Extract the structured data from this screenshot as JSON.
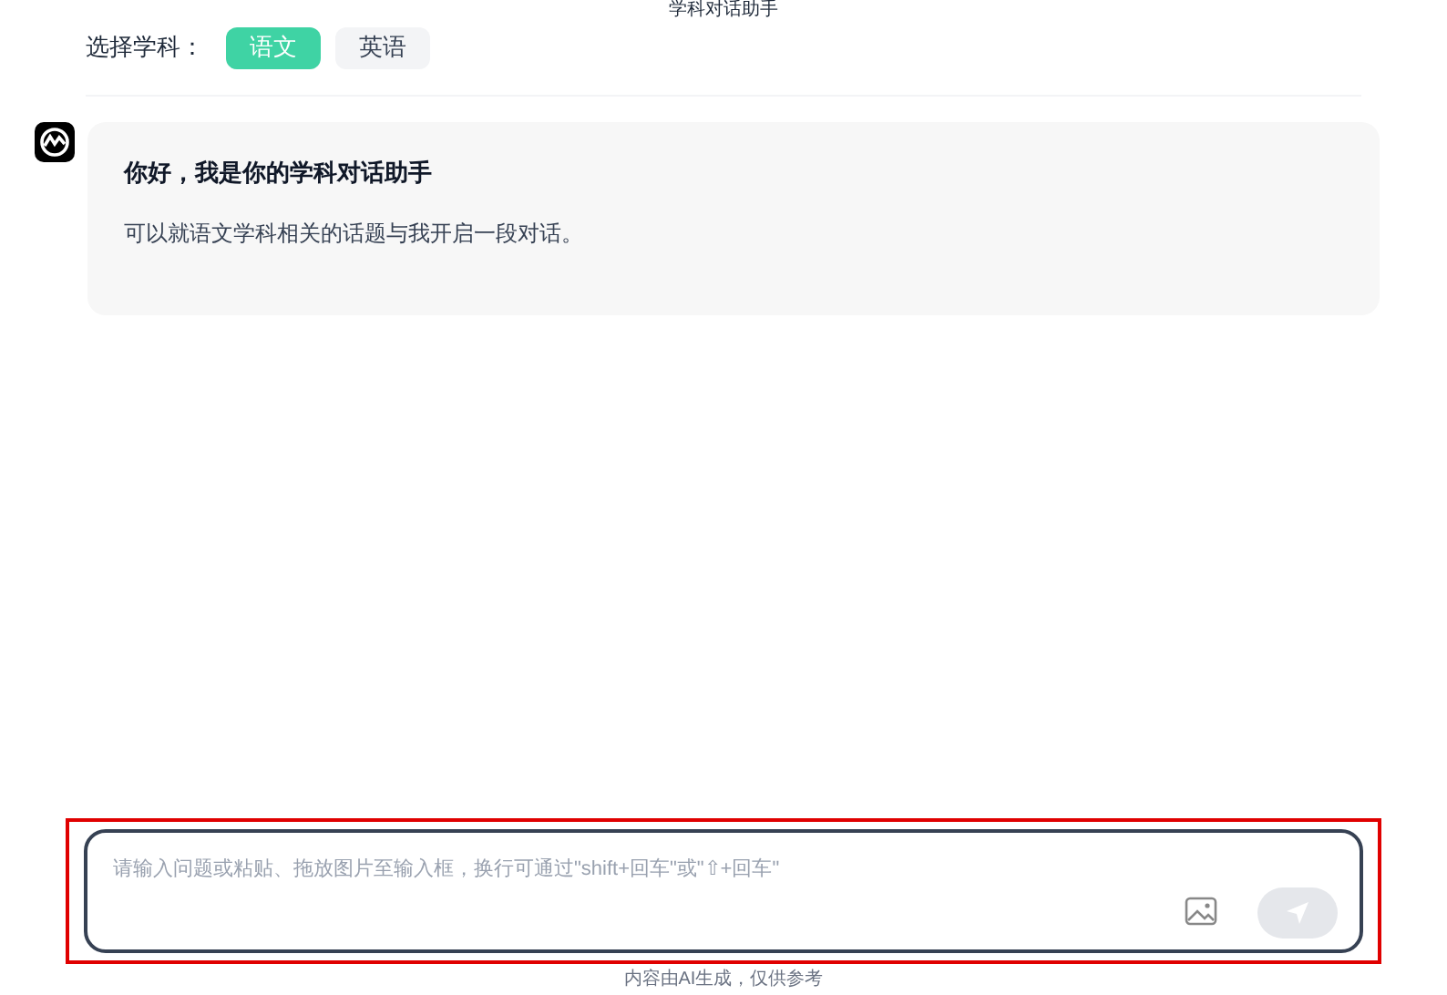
{
  "title": "学科对话助手",
  "subject_picker": {
    "label": "选择学科：",
    "options": [
      {
        "label": "语文",
        "selected": true
      },
      {
        "label": "英语",
        "selected": false
      }
    ]
  },
  "messages": [
    {
      "title": "你好，我是你的学科对话助手",
      "body": "可以就语文学科相关的话题与我开启一段对话。"
    }
  ],
  "input": {
    "placeholder": "请输入问题或粘贴、拖放图片至输入框，换行可通过\"shift+回车\"或\"⇧+回车\"",
    "send_disabled": true
  },
  "footer": "内容由AI生成，仅供参考"
}
